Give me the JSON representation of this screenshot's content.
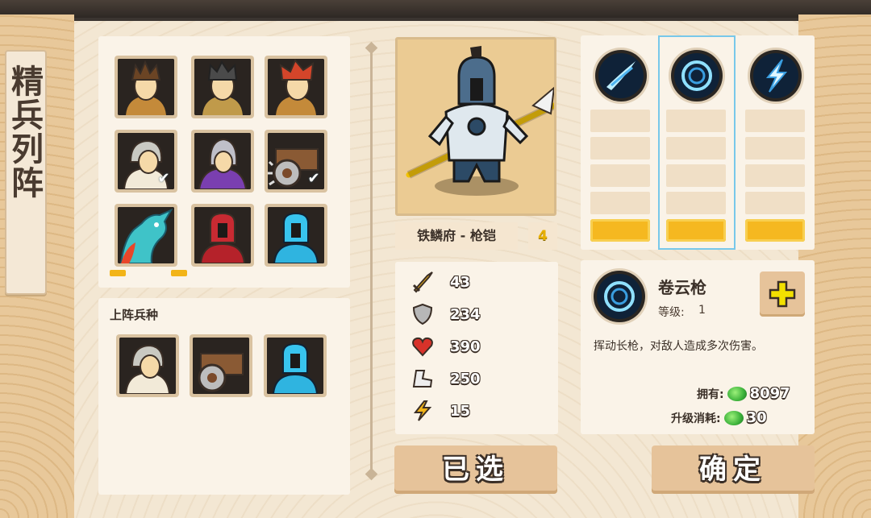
{
  "title": "精兵列阵",
  "roster": {
    "units": [
      {
        "name": "barbarian-brown",
        "checked": false
      },
      {
        "name": "barbarian-black",
        "checked": false
      },
      {
        "name": "barbarian-red",
        "checked": false
      },
      {
        "name": "hooded-monk",
        "checked": true
      },
      {
        "name": "purple-mage",
        "checked": false
      },
      {
        "name": "shield-cart",
        "checked": true
      },
      {
        "name": "cyan-dragon",
        "checked": false
      },
      {
        "name": "red-knight",
        "checked": false
      },
      {
        "name": "blue-knight",
        "checked": false
      }
    ]
  },
  "deployed": {
    "label": "上阵兵种",
    "units": [
      "hooded-monk",
      "shield-cart",
      "blue-knight"
    ]
  },
  "unit": {
    "name": "铁鳞府 - 枪铠",
    "level": "4",
    "stats": [
      {
        "icon": "sword-icon",
        "value": "43"
      },
      {
        "icon": "shield-icon",
        "value": "234"
      },
      {
        "icon": "heart-icon",
        "value": "390"
      },
      {
        "icon": "boot-icon",
        "value": "250"
      },
      {
        "icon": "lightning-icon",
        "value": "15"
      }
    ]
  },
  "skills": {
    "selected_index": 1,
    "items": [
      {
        "icon": "blade-slash-icon"
      },
      {
        "icon": "spiral-spear-icon"
      },
      {
        "icon": "lightning-strike-icon"
      }
    ]
  },
  "skill_detail": {
    "name": "卷云枪",
    "level_label": "等级:",
    "level_value": "1",
    "description": "挥动长枪，对敌人造成多次伤害。",
    "owned_label": "拥有:",
    "owned_value": "8097",
    "cost_label": "升级消耗:",
    "cost_value": "30"
  },
  "buttons": {
    "selected": "已选",
    "confirm": "确定"
  },
  "colors": {
    "panel_bg": "#f3e7d3",
    "card_bg": "#faf3e8",
    "gold": "#f5b820",
    "selection_outline": "#78c8ea",
    "gem": "#3bb13a"
  }
}
